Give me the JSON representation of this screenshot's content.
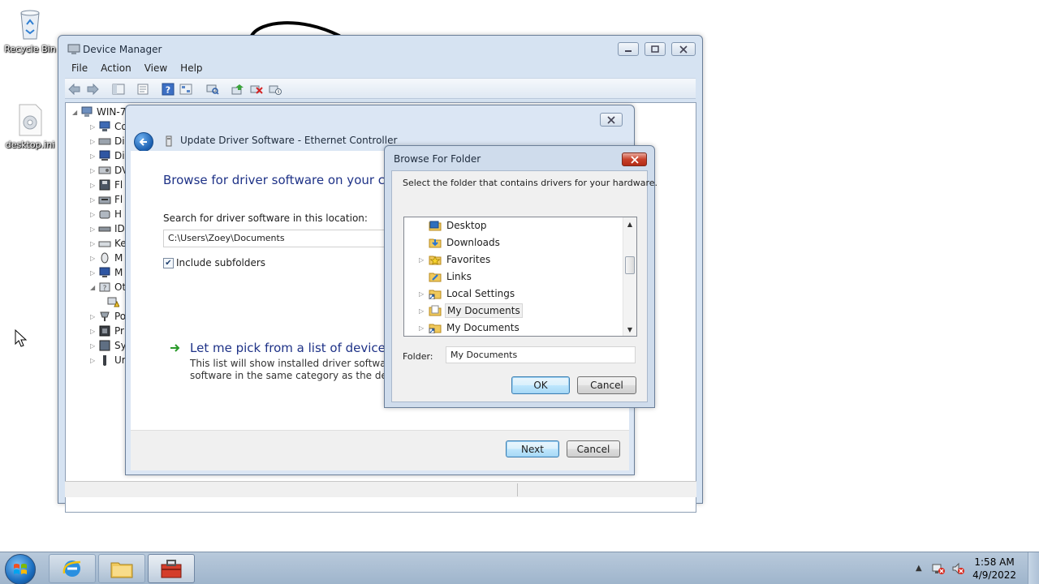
{
  "desktop": {
    "icons": [
      {
        "label": "Recycle Bin",
        "icon": "recycle-bin-icon"
      },
      {
        "label": "desktop.ini",
        "icon": "settings-file-icon"
      }
    ]
  },
  "device_manager": {
    "title": "Device Manager",
    "menu": [
      "File",
      "Action",
      "View",
      "Help"
    ],
    "tree_root": "WIN-7",
    "tree_items": [
      "Co",
      "Di",
      "Di",
      "DV",
      "Fl",
      "Fl",
      "H",
      "ID",
      "Ke",
      "M",
      "M",
      "Ot",
      "",
      "Po",
      "Pr",
      "Sy",
      "Ur"
    ]
  },
  "update_driver": {
    "title": "Update Driver Software - Ethernet Controller",
    "heading": "Browse for driver software on your com",
    "search_label": "Search for driver software in this location:",
    "path_value": "C:\\Users\\Zoey\\Documents",
    "include_subfolders_label": "Include subfolders",
    "pick_link": "Let me pick from a list of device dri",
    "pick_desc_line1": "This list will show installed driver software co",
    "pick_desc_line2": "software in the same category as the device.",
    "next_label": "Next",
    "cancel_label": "Cancel"
  },
  "browse_folder": {
    "title": "Browse For Folder",
    "instruction": "Select the folder that contains drivers for your hardware.",
    "items": [
      {
        "label": "Desktop",
        "icon": "folder-icon",
        "expandable": false
      },
      {
        "label": "Downloads",
        "icon": "downloads-folder-icon",
        "expandable": false
      },
      {
        "label": "Favorites",
        "icon": "favorites-folder-icon",
        "expandable": true
      },
      {
        "label": "Links",
        "icon": "links-folder-icon",
        "expandable": false
      },
      {
        "label": "Local Settings",
        "icon": "shortcut-folder-icon",
        "expandable": true
      },
      {
        "label": "My Documents",
        "icon": "documents-folder-icon",
        "expandable": true
      },
      {
        "label": "My Documents",
        "icon": "shortcut-folder-icon",
        "expandable": true
      }
    ],
    "selected_index": 5,
    "folder_label": "Folder:",
    "folder_value": "My Documents",
    "ok_label": "OK",
    "cancel_label": "Cancel"
  },
  "taskbar": {
    "pinned": [
      "internet-explorer-icon",
      "file-explorer-icon",
      "toolbox-icon"
    ],
    "time": "1:58 AM",
    "date": "4/9/2022"
  },
  "colors": {
    "heading_blue": "#1e3287",
    "link_green": "#2a9a2a",
    "taskbar": "#a9bdd2"
  }
}
